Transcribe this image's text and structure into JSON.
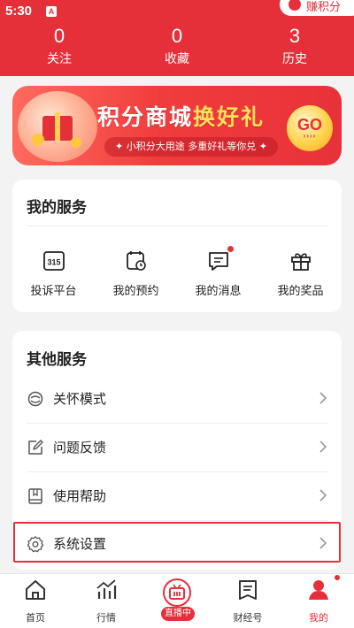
{
  "status": {
    "time": "5:30",
    "indicator": "A"
  },
  "earn_points": {
    "label": "赚积分"
  },
  "stats": [
    {
      "value": "0",
      "label": "关注"
    },
    {
      "value": "0",
      "label": "收藏"
    },
    {
      "value": "3",
      "label": "历史"
    }
  ],
  "banner": {
    "title_part1": "积分商城",
    "title_part2": "换好礼",
    "subtitle": "✦ 小积分大用途  多重好礼等你兑 ✦",
    "go_label": "GO",
    "go_arrows": "››››"
  },
  "my_services": {
    "title": "我的服务",
    "items": [
      {
        "label": "投诉平台",
        "icon": "complaint-315-icon"
      },
      {
        "label": "我的预约",
        "icon": "calendar-clock-icon"
      },
      {
        "label": "我的消息",
        "icon": "message-icon",
        "has_dot": true
      },
      {
        "label": "我的奖品",
        "icon": "gift-icon"
      }
    ]
  },
  "other_services": {
    "title": "其他服务",
    "items": [
      {
        "label": "关怀模式",
        "icon": "care-mode-icon"
      },
      {
        "label": "问题反馈",
        "icon": "feedback-icon"
      },
      {
        "label": "使用帮助",
        "icon": "help-book-icon"
      },
      {
        "label": "系统设置",
        "icon": "settings-gear-icon"
      }
    ]
  },
  "bottom_nav": [
    {
      "label": "首页",
      "icon": "home-icon"
    },
    {
      "label": "行情",
      "icon": "market-chart-icon"
    },
    {
      "label": "直播中",
      "icon": "live-tv-icon"
    },
    {
      "label": "财经号",
      "icon": "finance-account-icon"
    },
    {
      "label": "我的",
      "icon": "profile-icon",
      "active": true
    }
  ],
  "colors": {
    "brand_red": "#e5303a",
    "background": "#f3f3f3"
  }
}
